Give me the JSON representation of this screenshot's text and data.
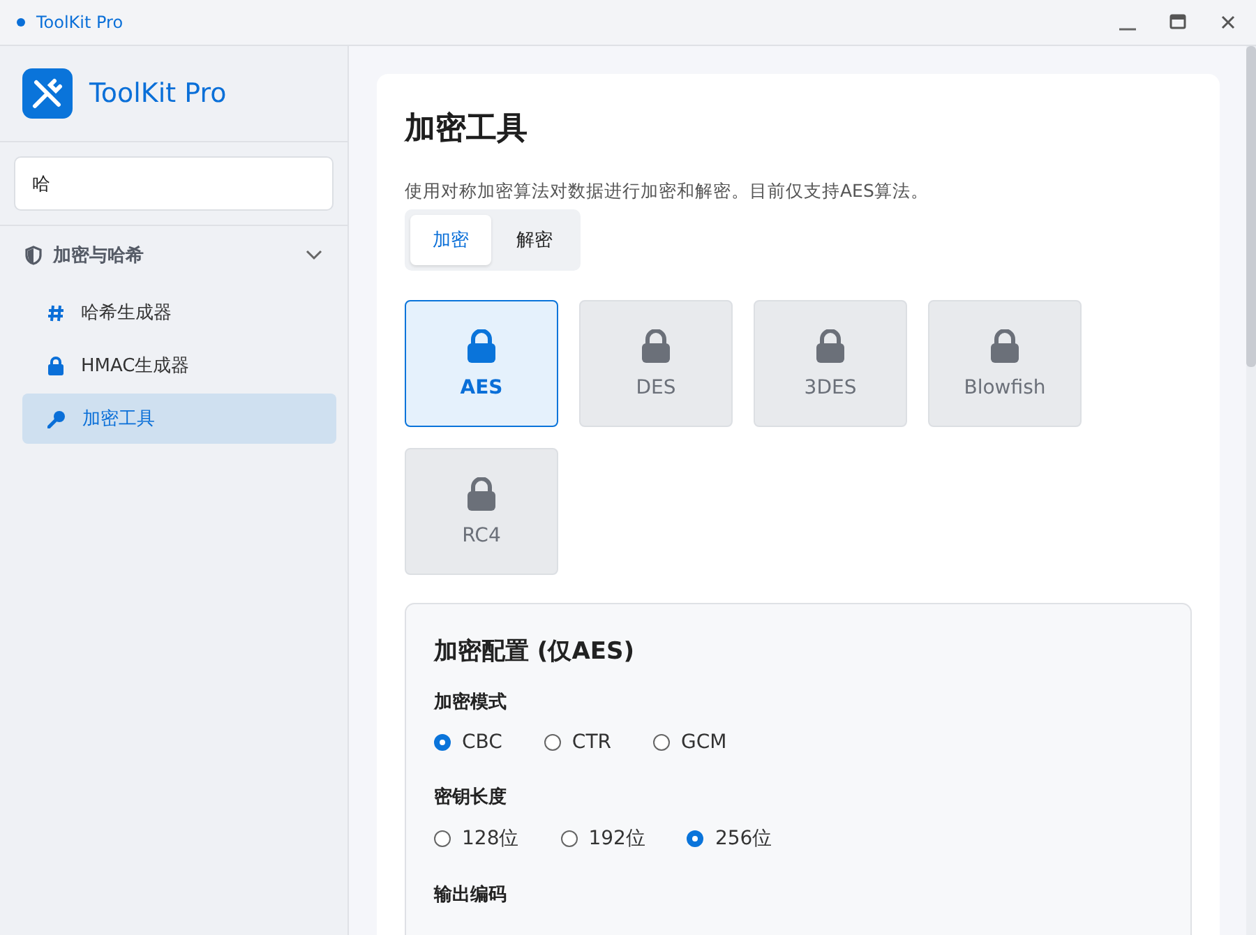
{
  "window": {
    "title": "ToolKit Pro"
  },
  "sidebar": {
    "brand": "ToolKit Pro",
    "search": {
      "value": "哈"
    },
    "groups": [
      {
        "label": "加密与哈希",
        "expanded": true,
        "items": [
          {
            "label": "哈希生成器",
            "kind": "hash",
            "selected": false
          },
          {
            "label": "HMAC生成器",
            "kind": "lock",
            "selected": false
          },
          {
            "label": "加密工具",
            "kind": "key",
            "selected": true
          }
        ]
      }
    ]
  },
  "page": {
    "title": "加密工具",
    "description": "使用对称加密算法对数据进行加密和解密。目前仅支持AES算法。",
    "tabs": [
      {
        "label": "加密",
        "selected": true
      },
      {
        "label": "解密",
        "selected": false
      }
    ],
    "algorithms": [
      {
        "label": "AES",
        "selected": true
      },
      {
        "label": "DES",
        "selected": false
      },
      {
        "label": "3DES",
        "selected": false
      },
      {
        "label": "Blowfish",
        "selected": false
      },
      {
        "label": "RC4",
        "selected": false
      }
    ],
    "config": {
      "title": "加密配置 (仅AES)",
      "groups": [
        {
          "label": "加密模式",
          "options": [
            {
              "label": "CBC",
              "selected": true
            },
            {
              "label": "CTR",
              "selected": false
            },
            {
              "label": "GCM",
              "selected": false
            }
          ]
        },
        {
          "label": "密钥长度",
          "options": [
            {
              "label": "128位",
              "selected": false
            },
            {
              "label": "192位",
              "selected": false
            },
            {
              "label": "256位",
              "selected": true
            }
          ]
        },
        {
          "label": "输出编码"
        }
      ]
    }
  }
}
